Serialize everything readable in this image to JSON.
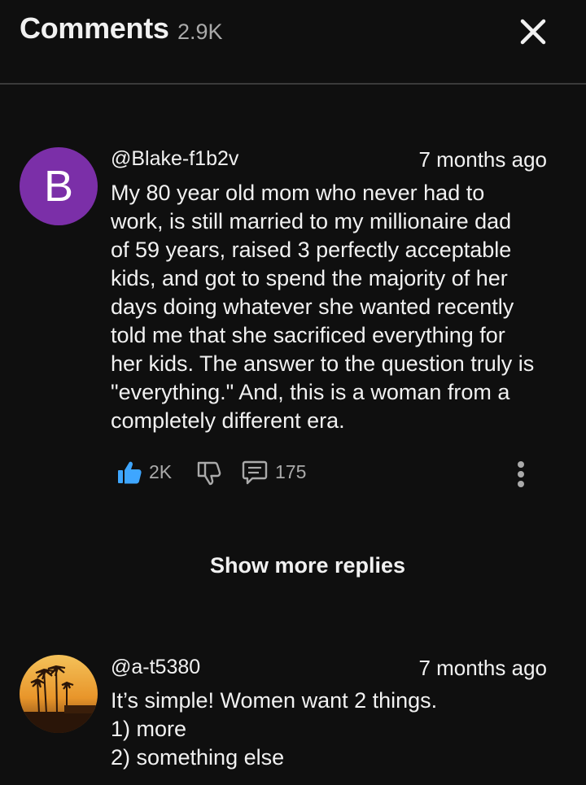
{
  "header": {
    "title": "Comments",
    "count": "2.9K"
  },
  "comments": [
    {
      "avatar_letter": "B",
      "author": "@Blake-f1b2v",
      "time": "7 months ago",
      "lines": [
        "My 80 year old mom who never had to",
        "work, is still married to my millionaire dad",
        "of 59 years, raised 3 perfectly acceptable",
        "kids, and got to spend the majority of her",
        "days doing whatever she wanted recently",
        "told me that she sacrificed everything for",
        "her kids. The answer to the question truly is",
        "\"everything.\" And, this is a woman from a",
        "completely different era."
      ],
      "likes": "2K",
      "replies": "175"
    },
    {
      "author": "@a-t5380",
      "time": "7 months ago",
      "lines": [
        "It’s simple! Women want 2 things.",
        "1) more",
        "2) something else"
      ]
    }
  ],
  "show_more_replies": "Show more replies",
  "colors": {
    "background": "#0f0f0f",
    "avatar_purple": "#7b2fa8",
    "like_blue": "#3ea6ff"
  },
  "icons": [
    "close-icon",
    "thumbs-up-icon",
    "thumbs-down-icon",
    "reply-icon",
    "more-vert-icon"
  ]
}
